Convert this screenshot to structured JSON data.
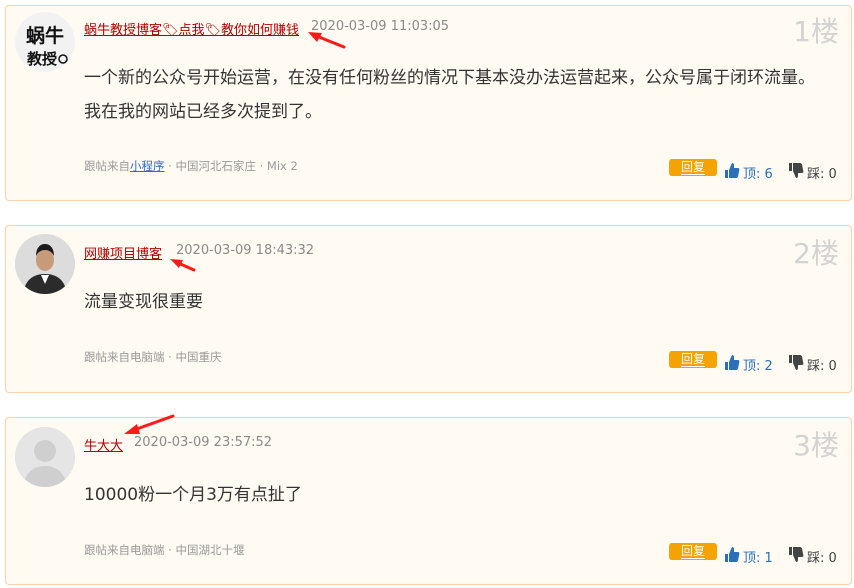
{
  "posts": [
    {
      "author": "蜗牛教授博客🏷点我🏷教你如何赚钱",
      "avatar_text": "蜗牛教授",
      "time": "2020-03-09 11:03:05",
      "floor": "1楼",
      "content": "一个新的公众号开始运营，在没有任何粉丝的情况下基本没办法运营起来，公众号属于闭环流量。我在我的网站已经多次提到了。",
      "source_prefix": "跟帖来自",
      "source_link": "小程序",
      "source_suffix": " · 中国河北石家庄 · Mix 2",
      "reply_label": "回复",
      "up_label": "顶: 6",
      "down_label": "踩: 0"
    },
    {
      "author": "网赚项目博客",
      "time": "2020-03-09 18:43:32",
      "floor": "2楼",
      "content": "流量变现很重要",
      "source_prefix": "跟帖来自电脑端 · 中国重庆",
      "reply_label": "回复",
      "up_label": "顶: 2",
      "down_label": "踩: 0"
    },
    {
      "author": "牛大大",
      "time": "2020-03-09 23:57:52",
      "floor": "3楼",
      "content": "10000粉一个月3万有点扯了",
      "source_prefix": "跟帖来自电脑端 · 中国湖北十堰",
      "reply_label": "回复",
      "up_label": "顶: 1",
      "down_label": "踩: 0"
    }
  ],
  "colors": {
    "card_bg": "#fffaf2",
    "card_border": "#f7d3ad",
    "author": "#b00000",
    "reply_button": "#f4a300",
    "up_vote": "#2a6fb8",
    "annotation_arrow": "#ff1a1a"
  },
  "icons": [
    "thumbs-up-icon",
    "thumbs-down-icon",
    "red-annotation-arrow"
  ]
}
